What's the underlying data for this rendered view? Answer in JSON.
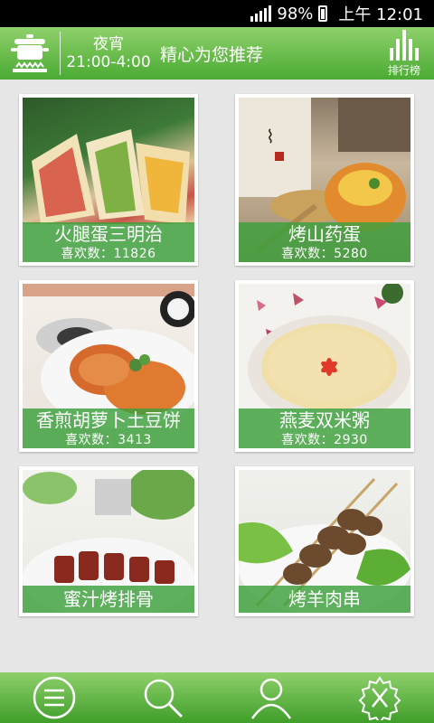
{
  "status": {
    "battery": "98%",
    "time": "上午 12:01"
  },
  "header": {
    "night_label": "夜宵",
    "time_range": "21:00-4:00",
    "title": "精心为您推荐",
    "ranking_label": "排行榜"
  },
  "cards": [
    {
      "name": "火腿蛋三明治",
      "likes": "喜欢数：11826"
    },
    {
      "name": "烤山药蛋",
      "likes": "喜欢数：5280"
    },
    {
      "name": "香煎胡萝卜土豆饼",
      "likes": "喜欢数：3413"
    },
    {
      "name": "燕麦双米粥",
      "likes": "喜欢数：2930"
    },
    {
      "name": "蜜汁烤排骨"
    },
    {
      "name": "烤羊肉串"
    }
  ],
  "nav": {
    "icons": [
      "menu-icon",
      "search-icon",
      "user-icon",
      "settings-icon"
    ]
  },
  "colors": {
    "header_green": "#4aab33",
    "caption_green": "#3ca03c"
  }
}
